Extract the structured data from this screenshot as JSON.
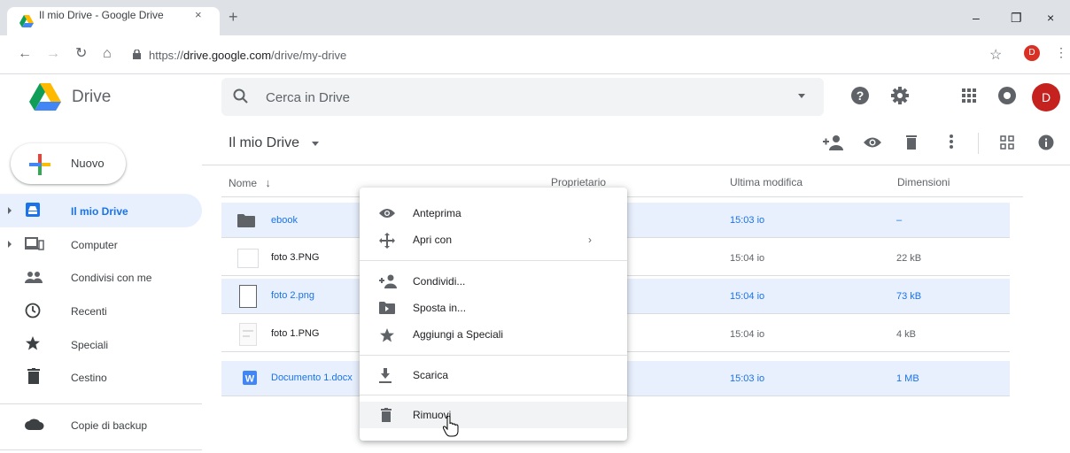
{
  "browser": {
    "tab_title": "Il mio Drive - Google Drive",
    "tab_close": "×",
    "new_tab": "+",
    "url_prefix": "https://",
    "url_host": "drive.google.com",
    "url_path": "/drive/my-drive",
    "profile_letter": "D",
    "minimize": "–",
    "restore": "❐",
    "close": "×"
  },
  "drive": {
    "title": "Drive",
    "search_placeholder": "Cerca in Drive",
    "avatar_letter": "D"
  },
  "sidebar": {
    "new_button": "Nuovo",
    "items": [
      {
        "label": "Il mio Drive",
        "active": true
      },
      {
        "label": "Computer"
      },
      {
        "label": "Condivisi con me"
      },
      {
        "label": "Recenti"
      },
      {
        "label": "Speciali"
      },
      {
        "label": "Cestino"
      },
      {
        "label": "Copie di backup"
      }
    ]
  },
  "main": {
    "title": "Il mio Drive",
    "columns": [
      "Nome",
      "Proprietario",
      "Ultima modifica",
      "Dimensioni"
    ],
    "rows": [
      {
        "name": "ebook",
        "modified": "15:03 io",
        "size": "–",
        "selected": true
      },
      {
        "name": "foto 3.PNG",
        "modified": "15:04 io",
        "size": "22 kB",
        "selected": false
      },
      {
        "name": "foto 2.png",
        "modified": "15:04 io",
        "size": "73 kB",
        "selected": true
      },
      {
        "name": "foto 1.PNG",
        "modified": "15:04 io",
        "size": "4 kB",
        "selected": false
      },
      {
        "name": "Documento 1.docx",
        "modified": "15:03 io",
        "size": "1 MB",
        "selected": true
      }
    ]
  },
  "context_menu": {
    "items": [
      {
        "label": "Anteprima",
        "icon": "eye-icon"
      },
      {
        "label": "Apri con",
        "icon": "move-icon",
        "submenu": true
      },
      {
        "label": "Condividi...",
        "icon": "person-add-icon"
      },
      {
        "label": "Sposta in...",
        "icon": "folder-move-icon"
      },
      {
        "label": "Aggiungi a Speciali",
        "icon": "star-icon"
      },
      {
        "label": "Scarica",
        "icon": "download-icon"
      },
      {
        "label": "Rimuovi",
        "icon": "trash-icon",
        "hover": true
      }
    ],
    "chevron": "›"
  },
  "colors": {
    "accent": "#1a73e8",
    "selection": "#e8f0fe",
    "avatar": "#c5221f"
  }
}
